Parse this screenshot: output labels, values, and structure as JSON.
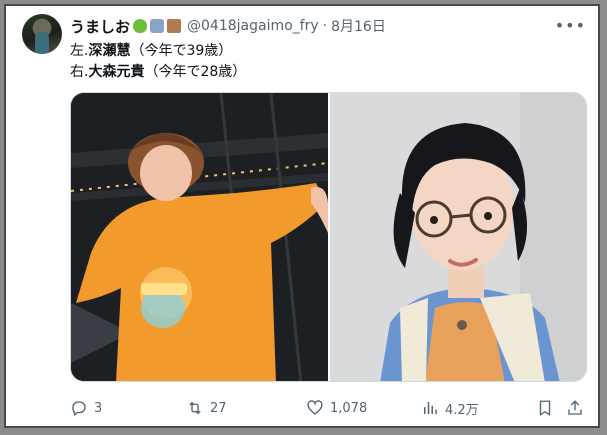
{
  "tweet": {
    "display_name": "うましお",
    "handle": "@0418jagaimo_fry",
    "separator": "·",
    "date": "8月16日",
    "lines": [
      {
        "prefix": "左.",
        "name": "深瀬慧",
        "suffix": "（今年で39歳）"
      },
      {
        "prefix": "右.",
        "name": "大森元貴",
        "suffix": "（今年で28歳）"
      }
    ]
  },
  "actions": {
    "replies": "3",
    "retweets": "27",
    "likes": "1,078",
    "views": "4.2万"
  },
  "icons": {
    "more": "more-icon",
    "reply": "reply-icon",
    "retweet": "retweet-icon",
    "like": "heart-icon",
    "views": "views-chart-icon",
    "bookmark": "bookmark-icon",
    "share": "share-icon"
  },
  "colors": {
    "text_primary": "#0f1419",
    "text_secondary": "#536471",
    "card_border": "#4a4a4a",
    "background": "#8c8c8c",
    "left_shirt": "#f39a2c",
    "right_shirt": "#e8a15a",
    "right_cardigan": "#6b95d1"
  }
}
